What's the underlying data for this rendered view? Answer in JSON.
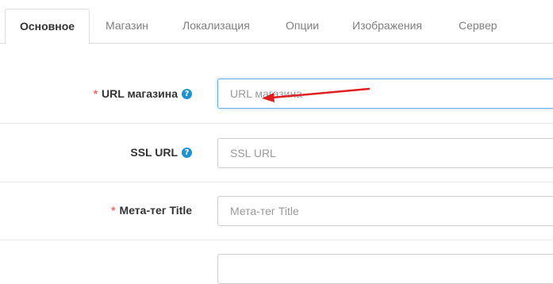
{
  "tabs": [
    {
      "label": "Основное",
      "active": true
    },
    {
      "label": "Магазин",
      "active": false
    },
    {
      "label": "Локализация",
      "active": false
    },
    {
      "label": "Опции",
      "active": false
    },
    {
      "label": "Изображения",
      "active": false
    },
    {
      "label": "Сервер",
      "active": false
    }
  ],
  "form": {
    "url": {
      "label": "URL магазина",
      "required": true,
      "help_icon": "question-circle-icon",
      "placeholder": "URL магазина",
      "value": ""
    },
    "ssl": {
      "label": "SSL URL",
      "required": false,
      "help_icon": "question-circle-icon",
      "placeholder": "SSL URL",
      "value": ""
    },
    "meta_title": {
      "label": "Мета-тег Title",
      "required": true,
      "placeholder": "Мета-тег Title",
      "value": ""
    }
  },
  "required_mark": "*",
  "help_glyph": "?",
  "colors": {
    "required": "#f56b6b",
    "help_icon": "#1e91cf",
    "annotation_arrow": "#e02020",
    "focus_border": "#66afe9"
  }
}
